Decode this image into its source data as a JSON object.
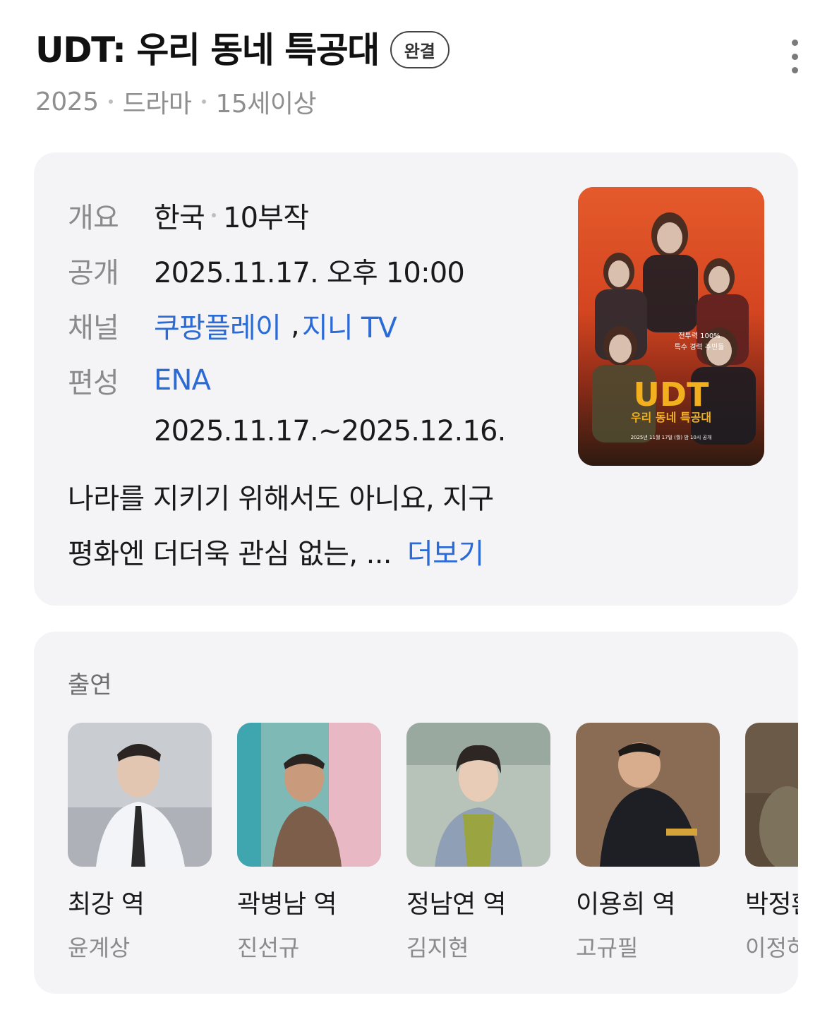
{
  "header": {
    "title": "UDT: 우리 동네 특공대",
    "status_badge": "완결",
    "meta": [
      "2025",
      "드라마",
      "15세이상"
    ]
  },
  "info": {
    "overview_label": "개요",
    "overview_country": "한국",
    "overview_episodes": "10부작",
    "release_label": "공개",
    "release_value": "2025.11.17. 오후 10:00",
    "channel_label": "채널",
    "channel_1": "쿠팡플레이",
    "channel_sep": ",",
    "channel_2": "지니 TV",
    "schedule_label": "편성",
    "schedule_network": "ENA",
    "schedule_period": "2025.11.17.~2025.12.16.",
    "description_line1": "나라를 지키기 위해서도 아니요, 지구",
    "description_line2": "평화엔 더더욱 관심 없는, ...",
    "more_label": "더보기"
  },
  "poster": {
    "tagline_1": "전투력 100%",
    "tagline_2": "특수 경력 주민들",
    "logo": "UDT",
    "subtitle": "우리 동네 특공대",
    "date_line": "2025년 11월 17일 (월) 밤 10시 공개"
  },
  "cast": {
    "heading": "출연",
    "members": [
      {
        "role": "최강 역",
        "actor": "윤계상"
      },
      {
        "role": "곽병남 역",
        "actor": "진선규"
      },
      {
        "role": "정남연 역",
        "actor": "김지현"
      },
      {
        "role": "이용희 역",
        "actor": "고규필"
      },
      {
        "role": "박정환",
        "actor": "이정하"
      }
    ]
  },
  "colors": {
    "link": "#2b6bd6",
    "card_bg": "#f4f4f6",
    "label_gray": "#8a8a8a",
    "poster_orange": "#e1532a"
  },
  "icons": {
    "more": "more-vertical-icon"
  }
}
